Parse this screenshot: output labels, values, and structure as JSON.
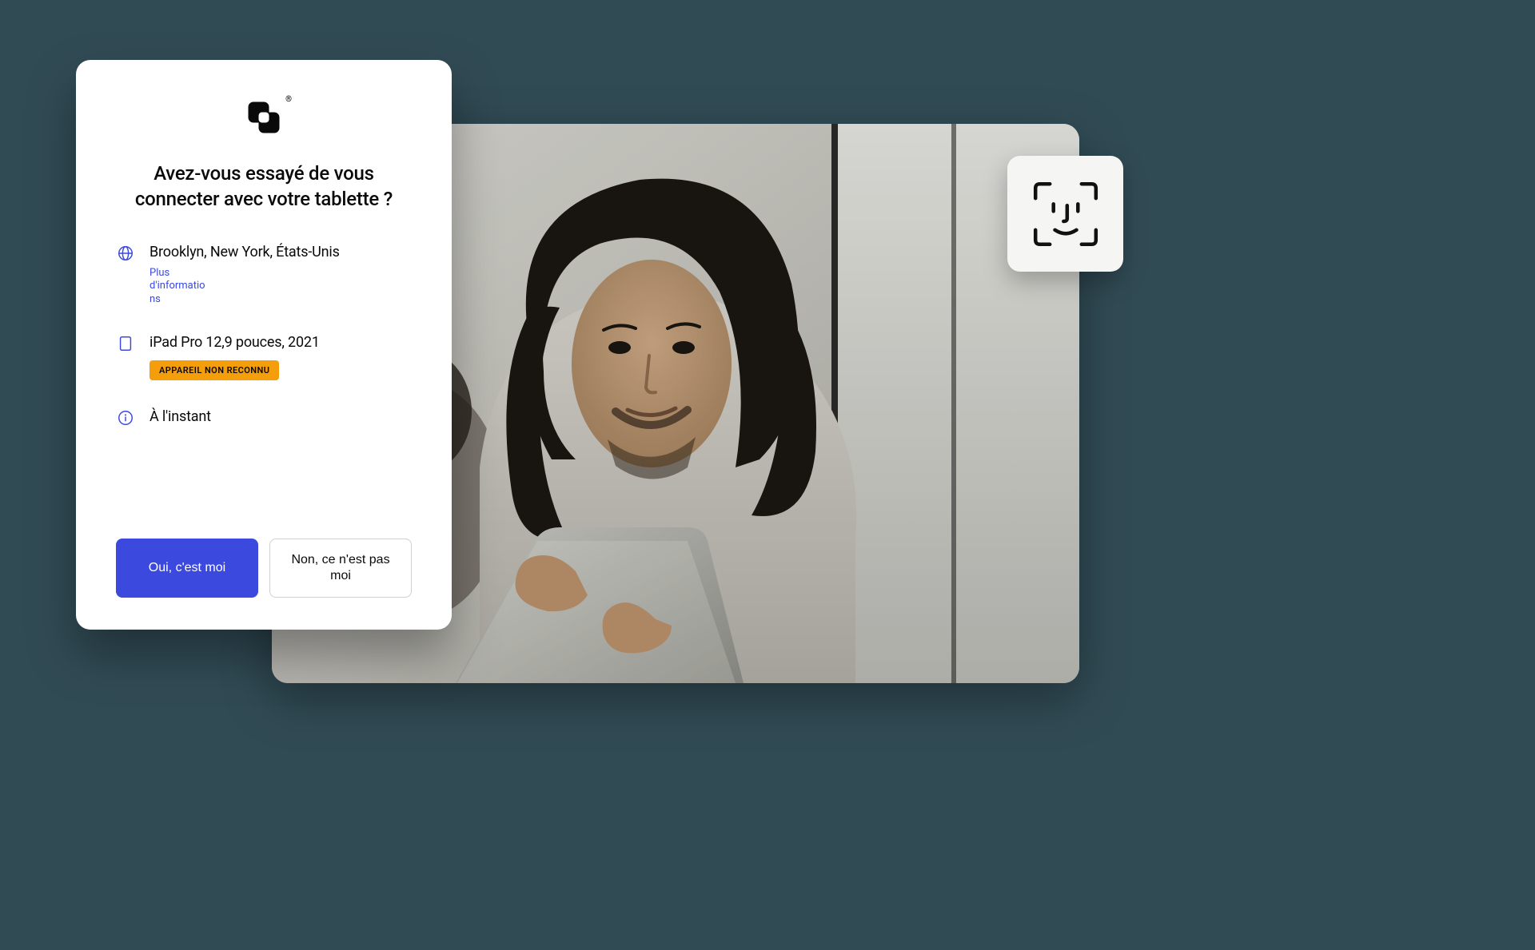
{
  "prompt": {
    "heading": "Avez-vous essayé de vous connecter avec votre tablette ?",
    "location": {
      "label": "Brooklyn, New York, États-Unis",
      "more_info": "Plus d'informations"
    },
    "device": {
      "label": "iPad Pro 12,9 pouces, 2021",
      "badge": "APPAREIL NON RECONNU"
    },
    "time": {
      "label": "À l'instant"
    },
    "buttons": {
      "confirm": "Oui, c'est moi",
      "deny": "Non, ce n'est pas moi"
    }
  },
  "colors": {
    "accent": "#3b49df",
    "badge_bg": "#f59e0b"
  }
}
